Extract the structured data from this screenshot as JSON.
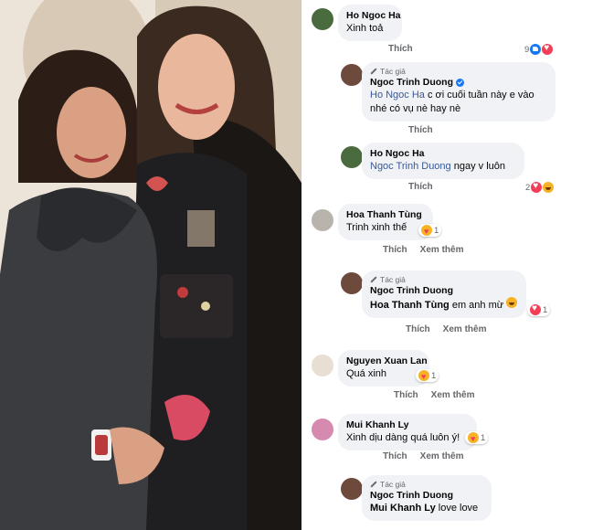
{
  "comments": [
    {
      "author": "Ho Ngoc Ha",
      "text": "Xinh toả",
      "actions": [
        "Thích"
      ],
      "reaction_count": "9",
      "reactions": [
        "like",
        "love"
      ]
    },
    {
      "author_tag": "Tác giả",
      "author": "Ngoc Trinh Duong",
      "mention": "Ho Ngoc Ha",
      "text": " c ơi cuối tuần này e vào",
      "text2": "nhé có vụ nè hay nè",
      "actions": [
        "Thích"
      ]
    },
    {
      "author": "Ho Ngoc Ha",
      "mention": "Ngoc Trinh Duong",
      "text": "  ngay v luôn",
      "actions": [
        "Thích"
      ],
      "reaction_count": "2",
      "reactions": [
        "love",
        "haha"
      ]
    },
    {
      "author": "Hoa Thanh Tùng",
      "text": "Trinh xinh thế",
      "reaction_count": "1",
      "reactions": [
        "care"
      ],
      "actions": [
        "Thích",
        "Xem thêm"
      ]
    },
    {
      "author_tag": "Tác giả",
      "author": "Ngoc Trinh Duong",
      "mention": "Hoa Thanh Tùng",
      "text": " em anh mừ",
      "reaction_count": "1",
      "reactions": [
        "love"
      ],
      "actions": [
        "Thích",
        "Xem thêm"
      ]
    },
    {
      "author": "Nguyen Xuan Lan",
      "text": "Quá xinh",
      "reaction_count": "1",
      "reactions": [
        "care"
      ],
      "actions": [
        "Thích",
        "Xem thêm"
      ]
    },
    {
      "author": "Mui Khanh Ly",
      "text": "Xinh dịu dàng quá luôn ý!",
      "reaction_count": "1",
      "reactions": [
        "care"
      ],
      "actions": [
        "Thích",
        "Xem thêm"
      ]
    },
    {
      "author_tag": "Tác giả",
      "author": "Ngoc Trinh Duong",
      "mention": "Mui Khanh Ly",
      "text": " love love"
    }
  ],
  "colors": {
    "bubble": "#f0f2f5",
    "mention": "#385898",
    "secondary": "#65676b",
    "like": "#1877f2",
    "love": "#f33e58"
  }
}
